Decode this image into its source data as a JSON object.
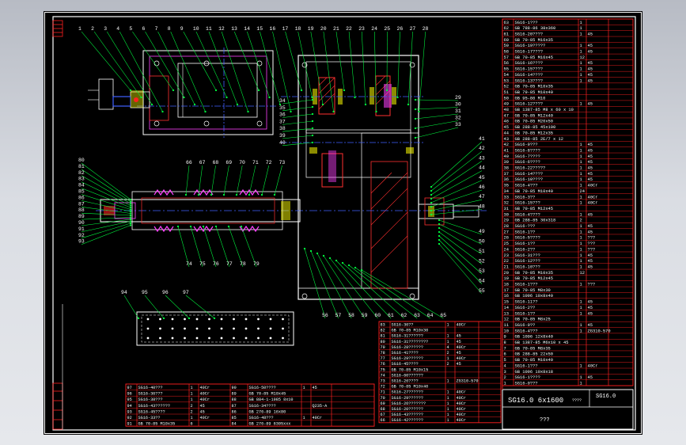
{
  "colors": {
    "background": "#000000",
    "frame": "#ffffff",
    "table_lines": "#ff2020",
    "text": "#ffffff",
    "leader": "#00ff40",
    "centerline": "#4060ff",
    "dim": "#ff40ff",
    "hatch": "#ff3030",
    "yellow": "#ffff00",
    "cyan": "#00ffff"
  },
  "balloons": {
    "top": [
      "1",
      "2",
      "3",
      "4",
      "5",
      "6",
      "7",
      "8",
      "9",
      "10",
      "11",
      "12",
      "13",
      "14",
      "15",
      "16",
      "17",
      "18",
      "19",
      "20",
      "21",
      "22",
      "23",
      "24",
      "25",
      "26",
      "27",
      "28"
    ],
    "left_gear": [
      "34",
      "35",
      "36",
      "37",
      "38",
      "39",
      "40"
    ],
    "right_upper": [
      "29",
      "30",
      "31",
      "32",
      "33"
    ],
    "right_mid": [
      "41",
      "42",
      "43",
      "44",
      "45",
      "46",
      "47",
      "48"
    ],
    "right_lower": [
      "49",
      "50",
      "51",
      "52",
      "53",
      "54",
      "55"
    ],
    "left_shaft": [
      "80",
      "81",
      "82",
      "83",
      "84",
      "85",
      "86",
      "87",
      "88",
      "89",
      "90",
      "91",
      "92",
      "93"
    ],
    "shaft_top": [
      "66",
      "67",
      "68",
      "69",
      "70",
      "71",
      "72",
      "73"
    ],
    "shaft_bottom": [
      "74",
      "75",
      "76",
      "77",
      "78",
      "79"
    ],
    "bottom": [
      "56",
      "57",
      "58",
      "59",
      "60",
      "61",
      "62",
      "63",
      "64",
      "65"
    ],
    "plate": [
      "94",
      "95",
      "96",
      "97"
    ]
  },
  "parts_list_right": [
    [
      "63",
      "SG16-1???",
      "1",
      ""
    ],
    [
      "62",
      "GB 788-86 38x360",
      "1",
      ""
    ],
    [
      "61",
      "SG16-20????",
      "1",
      "45"
    ],
    [
      "60",
      "GB 70-85 M16x35",
      "",
      ""
    ],
    [
      "59",
      "SG16-19?????",
      "1",
      "45"
    ],
    [
      "58",
      "SG16-17????",
      "1",
      "45"
    ],
    [
      "57",
      "GB 70-85 M16x45",
      "12",
      ""
    ],
    [
      "56",
      "SG16-16????",
      "1",
      "45"
    ],
    [
      "55",
      "SG16-15????",
      "1",
      "45"
    ],
    [
      "54",
      "SG16-14????",
      "1",
      "45"
    ],
    [
      "53",
      "SG16-13????",
      "1",
      "45"
    ],
    [
      "52",
      "GB 70-85 M10x35",
      "",
      ""
    ],
    [
      "51",
      "GB 79-85 M10x40",
      "",
      ""
    ],
    [
      "50",
      "GB 95-86 M10",
      "",
      ""
    ],
    [
      "49",
      "SG16-12????",
      "1",
      "45"
    ],
    [
      "48",
      "GB 1387-85 M8 x 60 x 10",
      "",
      ""
    ],
    [
      "47",
      "GB 70-85 M12x40",
      "",
      ""
    ],
    [
      "46",
      "GB 70-85 M20x50",
      "",
      ""
    ],
    [
      "45",
      "GB 288-85 45x100",
      "",
      ""
    ],
    [
      "44",
      "GB 70-85 M12x35",
      "",
      ""
    ],
    [
      "43",
      "GB 288-85 2E/7 x 12",
      "",
      ""
    ],
    [
      "42",
      "SG16-9???",
      "1",
      "45"
    ],
    [
      "41",
      "SG16-8????",
      "1",
      "45"
    ],
    [
      "40",
      "SG16-7????",
      "1",
      "45"
    ],
    [
      "39",
      "SG16-6????",
      "1",
      "45"
    ],
    [
      "38",
      "SG16-22?????",
      "1",
      "45"
    ],
    [
      "37",
      "SG16-14????",
      "1",
      "45"
    ],
    [
      "36",
      "SG16-10????",
      "1",
      "45"
    ],
    [
      "35",
      "SG16-4???",
      "1",
      "40Cr"
    ],
    [
      "34",
      "GB 70-85 M10x40",
      "24",
      ""
    ],
    [
      "33",
      "SG16-3??",
      "1",
      "40Cr"
    ],
    [
      "32",
      "SG16-15???",
      "1",
      "40Cr"
    ],
    [
      "31",
      "GB 70-85 M12x45",
      "",
      ""
    ],
    [
      "30",
      "SG16-4????",
      "1",
      "45"
    ],
    [
      "29",
      "GB 288-85 30x318",
      "2",
      ""
    ],
    [
      "28",
      "SG16-???",
      "1",
      "45"
    ],
    [
      "27",
      "SG16-1??",
      "1",
      "45"
    ],
    [
      "26",
      "SG16-5????",
      "1",
      "???"
    ],
    [
      "25",
      "SG16-1??",
      "1",
      "???"
    ],
    [
      "24",
      "SG16-2??",
      "1",
      "???"
    ],
    [
      "23",
      "SG16-31???",
      "1",
      "45"
    ],
    [
      "22",
      "SG16-12???",
      "1",
      "45"
    ],
    [
      "21",
      "SG16-10???",
      "1",
      "45"
    ],
    [
      "20",
      "GB 70-85 M10x35",
      "12",
      ""
    ],
    [
      "19",
      "GB 70-85 M12x45",
      "",
      ""
    ],
    [
      "18",
      "SG16-1???",
      "1",
      "???"
    ],
    [
      "17",
      "GB 70-85 M8x30",
      "",
      ""
    ],
    [
      "16",
      "GB 1096 10x8x40",
      "",
      ""
    ],
    [
      "15",
      "SG16-11??",
      "1",
      "45"
    ],
    [
      "14",
      "SG16-2??",
      "1",
      "45"
    ],
    [
      "13",
      "SG16-1??",
      "1",
      "45"
    ],
    [
      "12",
      "GB 70-85 M8x25",
      "",
      ""
    ],
    [
      "11",
      "SG16-9??",
      "1",
      "45"
    ],
    [
      "10",
      "SG16-4???",
      "1",
      "ZG310-570"
    ],
    [
      "9",
      "GB 1096 12x8x40",
      "",
      ""
    ],
    [
      "8",
      "GB 1387-85 M6x10 x 45",
      "",
      ""
    ],
    [
      "7",
      "GB 70-85 M8x35",
      "",
      ""
    ],
    [
      "6",
      "GB 288-85 22x50",
      "",
      ""
    ],
    [
      "5",
      "GB 70-85 M10x40",
      "",
      ""
    ],
    [
      "4",
      "SG16-1???",
      "1",
      "40Cr"
    ],
    [
      "3",
      "GB 1096 10x8x18",
      "",
      ""
    ],
    [
      "2",
      "SG16-1????",
      "1",
      "45"
    ],
    [
      "1",
      "SG16-0???",
      "1",
      ""
    ]
  ],
  "parts_list_middle": [
    [
      "83",
      "SG16-36??",
      "1",
      "40Cr"
    ],
    [
      "82",
      "GB 70-85 M10x30",
      "",
      ""
    ],
    [
      "81",
      "SG16-31??????",
      "1",
      "45"
    ],
    [
      "80",
      "SG16-31????????",
      "1",
      "45"
    ],
    [
      "79",
      "SG16-28??????",
      "4",
      "40Cr"
    ],
    [
      "78",
      "SG16-41????",
      "2",
      "45"
    ],
    [
      "77",
      "SG16-29??????",
      "1",
      "40Cr"
    ],
    [
      "76",
      "SG16-45????",
      "2",
      "45"
    ],
    [
      "75",
      "GB 70-85 M10x15",
      "",
      ""
    ],
    [
      "74",
      "SG16-60??????",
      "",
      ""
    ],
    [
      "73",
      "SG16-26????",
      "1",
      "ZG310-570"
    ],
    [
      "72",
      "GB 70-85 M10x40",
      "",
      ""
    ],
    [
      "71",
      "SG16-27??????",
      "1",
      "40Cr"
    ],
    [
      "70",
      "SG16-29??????",
      "1",
      "40Cr"
    ],
    [
      "69",
      "SG16-26???????",
      "1",
      "40Cr"
    ],
    [
      "68",
      "SG16-20??????",
      "1",
      "40Cr"
    ],
    [
      "67",
      "SG16-43??????",
      "1",
      "40Cr"
    ],
    [
      "66",
      "SG16-42??????",
      "1",
      "40Cr"
    ]
  ],
  "parts_list_left": [
    [
      "97",
      "SG16-40???",
      "1",
      "40Cr",
      "90",
      "SG16-50????",
      "1",
      "45"
    ],
    [
      "96",
      "SG16-36???",
      "1",
      "40Cr",
      "89",
      "GB 70-85 M10x45",
      "",
      ""
    ],
    [
      "95",
      "SG16-38???",
      "1",
      "40Cr",
      "88",
      "GB 884-1-1985 8x10",
      "",
      ""
    ],
    [
      "94",
      "SG16-43??????",
      "2",
      "45",
      "87",
      "SG16-34????",
      "",
      "Q235-A"
    ],
    [
      "93",
      "SG16-45????",
      "2",
      "45",
      "86",
      "GB 276-89 16x80",
      "",
      ""
    ],
    [
      "92",
      "SG16-33??",
      "1",
      "40Cr",
      "85",
      "SG16-48???",
      "1",
      "40Cr"
    ],
    [
      "91",
      "GB 70-85 M10x35",
      "6",
      "",
      "84",
      "GB 276-89 6305xxx",
      "",
      ""
    ]
  ],
  "title_block": {
    "drawing_title": "SG16.0 6x1600",
    "drawing_code": "SG16.0",
    "company": "???",
    "symbols": "????"
  }
}
